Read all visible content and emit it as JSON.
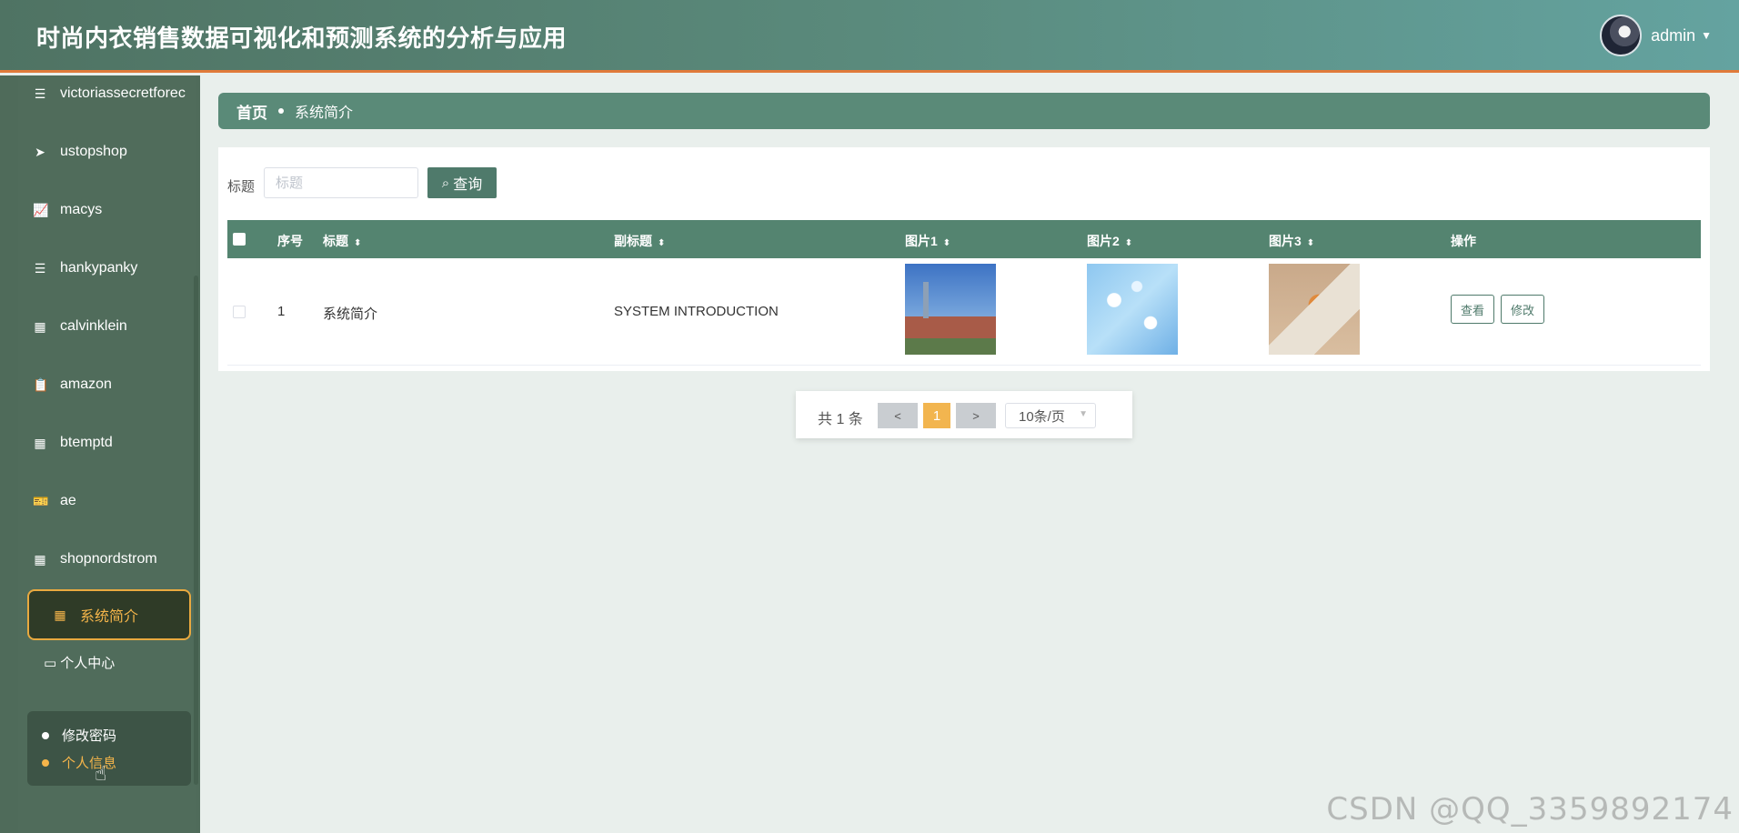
{
  "header": {
    "title": "时尚内衣销售数据可视化和预测系统的分析与应用",
    "username": "admin"
  },
  "sidebar": {
    "items": [
      {
        "label": "victoriassecretforec",
        "icon": "list-icon"
      },
      {
        "label": "ustopshop",
        "icon": "send-icon"
      },
      {
        "label": "macys",
        "icon": "chart-icon"
      },
      {
        "label": "hankypanky",
        "icon": "list-icon"
      },
      {
        "label": "calvinklein",
        "icon": "grid-icon"
      },
      {
        "label": "amazon",
        "icon": "clipboard-icon"
      },
      {
        "label": "btemptd",
        "icon": "grid-icon"
      },
      {
        "label": "ae",
        "icon": "ticket-icon"
      },
      {
        "label": "shopnordstrom",
        "icon": "grid-icon"
      },
      {
        "label": "系统简介",
        "icon": "grid-icon",
        "active": true
      }
    ],
    "personal_center": "个人中心",
    "submenu": [
      {
        "label": "修改密码",
        "color": "#ffffff"
      },
      {
        "label": "个人信息",
        "color": "#f5b54a"
      }
    ]
  },
  "breadcrumb": {
    "home": "首页",
    "current": "系统简介"
  },
  "search": {
    "label": "标题",
    "placeholder": "标题",
    "button": "查询"
  },
  "table": {
    "headers": {
      "index": "序号",
      "title": "标题",
      "subtitle": "副标题",
      "image1": "图片1",
      "image2": "图片2",
      "image3": "图片3",
      "actions": "操作"
    },
    "rows": [
      {
        "index": "1",
        "title": "系统简介",
        "subtitle": "SYSTEM INTRODUCTION",
        "view": "查看",
        "edit": "修改"
      }
    ]
  },
  "pagination": {
    "total": "共 1 条",
    "prev": "<",
    "page": "1",
    "next": ">",
    "page_size": "10条/页"
  },
  "watermark": "CSDN @QQ_3359892174",
  "colors": {
    "header_start": "#4f7363",
    "header_end": "#64a3a0",
    "sidebar": "#4f6b5a",
    "accent": "#f5b54a",
    "table_header": "#548470"
  }
}
